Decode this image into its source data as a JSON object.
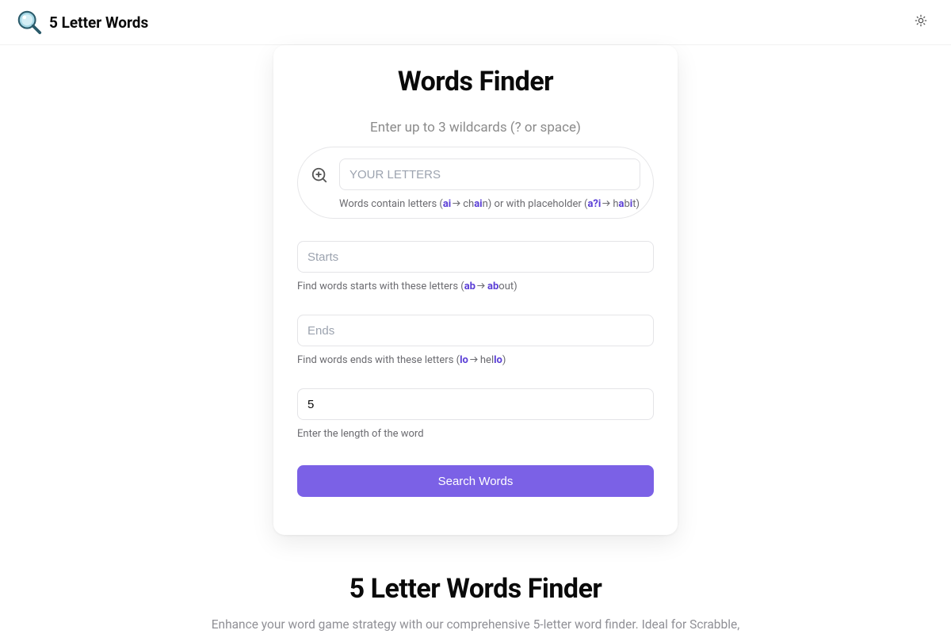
{
  "header": {
    "brand_title": "5 Letter Words"
  },
  "card": {
    "title": "Words Finder",
    "wildcards_hint": "Enter up to 3 wildcards (? or space)",
    "letters": {
      "placeholder": "YOUR LETTERS",
      "hint_prefix": "Words contain letters (",
      "hint_ex1": "ai",
      "hint_mid1a": "ch",
      "hint_ex1b": "ai",
      "hint_mid1b": "n) or with placeholder (",
      "hint_ex2": "a?i",
      "hint_mid2a": "h",
      "hint_ex2b": "a",
      "hint_mid2b": "b",
      "hint_ex2c": "i",
      "hint_mid2c": "t)"
    },
    "starts": {
      "placeholder": "Starts",
      "hint_prefix": "Find words starts with these letters (",
      "hint_ex1": "ab",
      "hint_ex2": "ab",
      "hint_tail": "out)"
    },
    "ends": {
      "placeholder": "Ends",
      "hint_prefix": "Find words ends with these letters (",
      "hint_ex1": "lo",
      "hint_mid": "hel",
      "hint_ex2": "lo",
      "hint_tail": ")"
    },
    "length": {
      "value": "5",
      "hint": "Enter the length of the word"
    },
    "search_label": "Search Words"
  },
  "below": {
    "title": "5 Letter Words Finder",
    "description": "Enhance your word game strategy with our comprehensive 5-letter word finder. Ideal for Scrabble,"
  }
}
